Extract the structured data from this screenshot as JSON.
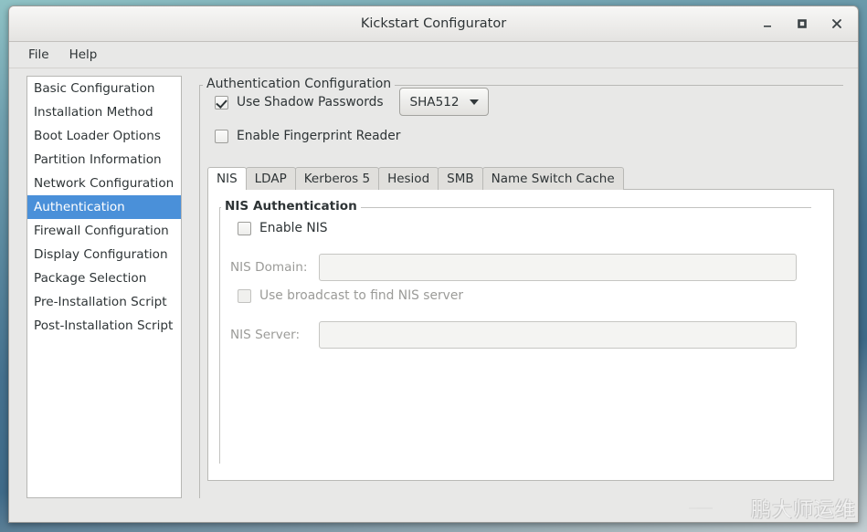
{
  "window": {
    "title": "Kickstart Configurator",
    "buttons": {
      "minimize": "minimize-icon",
      "maximize": "maximize-icon",
      "close": "close-icon"
    }
  },
  "menubar": {
    "items": [
      {
        "label": "File"
      },
      {
        "label": "Help"
      }
    ]
  },
  "sidebar": {
    "items": [
      {
        "label": "Basic Configuration",
        "selected": false
      },
      {
        "label": "Installation Method",
        "selected": false
      },
      {
        "label": "Boot Loader Options",
        "selected": false
      },
      {
        "label": "Partition Information",
        "selected": false
      },
      {
        "label": "Network Configuration",
        "selected": false
      },
      {
        "label": "Authentication",
        "selected": true
      },
      {
        "label": "Firewall Configuration",
        "selected": false
      },
      {
        "label": "Display Configuration",
        "selected": false
      },
      {
        "label": "Package Selection",
        "selected": false
      },
      {
        "label": "Pre-Installation Script",
        "selected": false
      },
      {
        "label": "Post-Installation Script",
        "selected": false
      }
    ],
    "selected_color": "#4a90d9"
  },
  "auth": {
    "frame_title": "Authentication Configuration",
    "use_shadow_passwords": {
      "label": "Use Shadow Passwords",
      "checked": true
    },
    "crypt_combo": {
      "value": "SHA512",
      "icon": "chevron-down-icon"
    },
    "enable_fingerprint_reader": {
      "label": "Enable Fingerprint Reader",
      "checked": false
    },
    "tabs": [
      {
        "label": "NIS",
        "active": true
      },
      {
        "label": "LDAP",
        "active": false
      },
      {
        "label": "Kerberos 5",
        "active": false
      },
      {
        "label": "Hesiod",
        "active": false
      },
      {
        "label": "SMB",
        "active": false
      },
      {
        "label": "Name Switch Cache",
        "active": false
      }
    ],
    "nis": {
      "frame_title": "NIS Authentication",
      "enable_nis": {
        "label": "Enable NIS",
        "checked": false,
        "disabled": false
      },
      "domain": {
        "label": "NIS Domain:",
        "value": "",
        "placeholder": "",
        "disabled": true
      },
      "use_broadcast": {
        "label": "Use broadcast to find NIS server",
        "checked": false,
        "disabled": true
      },
      "server": {
        "label": "NIS Server:",
        "value": "",
        "placeholder": "",
        "disabled": true
      }
    }
  },
  "watermark": {
    "text": "鹏大师运维",
    "icon": "wechat-icon"
  }
}
